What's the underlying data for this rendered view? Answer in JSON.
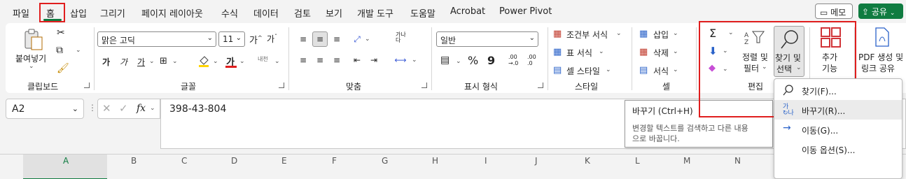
{
  "tabs": [
    "파일",
    "홈",
    "삽입",
    "그리기",
    "페이지 레이아웃",
    "수식",
    "데이터",
    "검토",
    "보기",
    "개발 도구",
    "도움말",
    "Acrobat",
    "Power Pivot"
  ],
  "header_buttons": {
    "memo": "메모",
    "share": "공유"
  },
  "clipboard": {
    "paste": "붙여넣기",
    "label": "클립보드"
  },
  "font": {
    "name": "맑은 고딕",
    "size": "11",
    "bold": "가",
    "italic": "가",
    "underline": "가",
    "color_glyph": "가",
    "label": "글꼴",
    "phonetic": "내천"
  },
  "alignment": {
    "label": "맞춤",
    "wrap": "가나\n다"
  },
  "number": {
    "format": "일반",
    "percent": "%",
    "comma": "9",
    "inc": ".00\n→.0",
    "dec": ".00\n.0",
    "label": "표시 형식"
  },
  "styles": {
    "conditional": "조건부 서식",
    "table": "표 서식",
    "cell": "셀 스타일",
    "label": "스타일"
  },
  "cells": {
    "insert": "삽입",
    "delete": "삭제",
    "format": "서식",
    "label": "셀"
  },
  "editing": {
    "sort_filter_1": "정렬 및",
    "sort_filter_2": "필터",
    "find_select_1": "찾기 및",
    "find_select_2": "선택",
    "label": "편집"
  },
  "addins": {
    "line1": "추가",
    "line2": "기능"
  },
  "acrobat": {
    "line1": "PDF 생성 및",
    "line2": "링크 공유"
  },
  "formula_bar": {
    "name_box": "A2",
    "fx": "fx",
    "value": "398-43-804"
  },
  "columns": [
    "A",
    "B",
    "C",
    "D",
    "E",
    "F",
    "G",
    "H",
    "I",
    "J",
    "K",
    "L",
    "M",
    "N"
  ],
  "tooltip": {
    "title": "바꾸기 (Ctrl+H)",
    "body": "변경할 텍스트를 검색하고 다른 내용으로 바꿉니다."
  },
  "dropdown": [
    {
      "label": "찾기(F)...",
      "icon": "search-icon"
    },
    {
      "label": "바꾸기(R)...",
      "icon": "replace-icon"
    },
    {
      "label": "이동(G)...",
      "icon": "arrow-right-icon"
    },
    {
      "label": "이동 옵션(S)...",
      "icon": ""
    }
  ],
  "colors": {
    "accent": "#107c41",
    "highlight_box": "#e01e1e"
  }
}
